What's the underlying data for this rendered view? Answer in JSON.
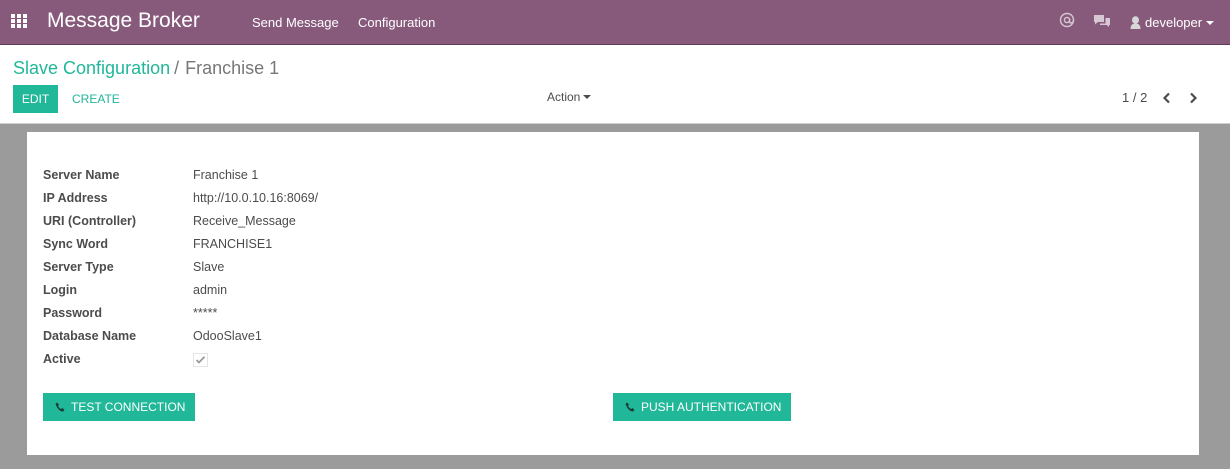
{
  "navbar": {
    "brand": "Message Broker",
    "menu": [
      "Send Message",
      "Configuration"
    ],
    "user": "developer",
    "icons": [
      "apps-grid-icon",
      "at-sign-icon",
      "chat-bubbles-icon",
      "user-avatar-icon"
    ]
  },
  "breadcrumb": {
    "parent": "Slave Configuration",
    "separator": "/",
    "current": "Franchise 1"
  },
  "toolbar": {
    "edit_label": "EDIT",
    "create_label": "CREATE",
    "action_label": "Action"
  },
  "pager": {
    "value": "1 / 2"
  },
  "form": {
    "fields": [
      {
        "label": "Server Name",
        "value": "Franchise 1"
      },
      {
        "label": "IP Address",
        "value": "http://10.0.10.16:8069/"
      },
      {
        "label": "URI (Controller)",
        "value": "Receive_Message"
      },
      {
        "label": "Sync Word",
        "value": "FRANCHISE1"
      },
      {
        "label": "Server Type",
        "value": "Slave"
      },
      {
        "label": "Login",
        "value": "admin"
      },
      {
        "label": "Password",
        "value": "*****"
      },
      {
        "label": "Database Name",
        "value": "OdooSlave1"
      }
    ],
    "active_label": "Active",
    "active_checked": true,
    "test_connection_label": "TEST CONNECTION",
    "push_authentication_label": "PUSH AUTHENTICATION"
  },
  "colors": {
    "navbar": "#875a7b",
    "accent": "#21b799",
    "background": "#9b9b9b"
  }
}
